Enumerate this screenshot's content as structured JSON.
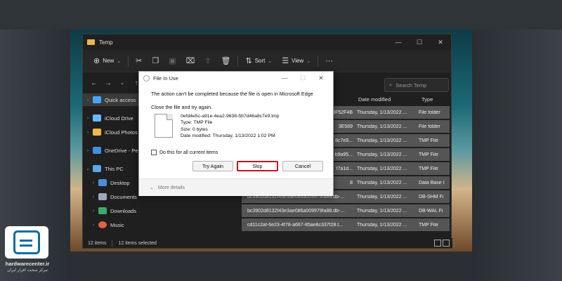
{
  "window": {
    "title": "Temp"
  },
  "toolbar": {
    "new_label": "New",
    "sort_label": "Sort",
    "view_label": "View",
    "more_label": "···"
  },
  "search": {
    "placeholder": "Search Temp"
  },
  "sidebar": {
    "items": [
      {
        "label": "Quick access",
        "icon": "star-icon",
        "color": "#4aa3ff"
      },
      {
        "label": "iCloud Drive",
        "icon": "cloud-icon",
        "color": "#6ab8ff"
      },
      {
        "label": "iCloud Photos",
        "icon": "photos-icon",
        "color": "#f0b84a"
      },
      {
        "label": "OneDrive - Pers",
        "icon": "cloud-icon",
        "color": "#3f8fe0"
      },
      {
        "label": "This PC",
        "icon": "computer-icon",
        "color": "#5aa6e8"
      },
      {
        "label": "Desktop",
        "icon": "desktop-icon",
        "color": "#4a90d9"
      },
      {
        "label": "Documents",
        "icon": "document-icon",
        "color": "#9aa8b8"
      },
      {
        "label": "Downloads",
        "icon": "download-icon",
        "color": "#3ea86f"
      },
      {
        "label": "Music",
        "icon": "music-icon",
        "color": "#e0604a"
      }
    ]
  },
  "file_list": {
    "columns": [
      "Date modified",
      "Type"
    ],
    "rows": [
      {
        "name": "",
        "id": "8F52F4B",
        "date": "Thursday, 1/13/2022 ...",
        "type": "File folder"
      },
      {
        "name": "",
        "id": "3E589",
        "date": "Thursday, 1/13/2022 ...",
        "type": "File folder"
      },
      {
        "name": "",
        "id": "8c7e9...",
        "date": "Thursday, 1/13/2022 ...",
        "type": "TMP File"
      },
      {
        "name": "",
        "id": "b9a95...",
        "date": "Thursday, 1/13/2022 ...",
        "type": "TMP File"
      },
      {
        "name": "",
        "id": "f7a1d...",
        "date": "Thursday, 1/13/2022 ...",
        "type": "TMP File"
      },
      {
        "name": "",
        "id": "8",
        "date": "Thursday, 1/13/2022 ...",
        "type": "Data Base I"
      },
      {
        "name": "bc3902d8132f43e3ae086a009979fa88.db-...",
        "date": "Thursday, 1/13/2022 ...",
        "type": "DB-SHM Fi"
      },
      {
        "name": "bc3902d8132f43e3ae086a009979fa88.db-...",
        "date": "Thursday, 1/13/2022 ...",
        "type": "DB-WAL Fi"
      },
      {
        "name": "cd11c2af-6e23-4f78-a667-85ae8c337f28.t...",
        "date": "Thursday, 1/13/2022 ...",
        "type": "TMP File"
      }
    ]
  },
  "status": {
    "count": "12 items",
    "selected": "12 items selected"
  },
  "dialog": {
    "title": "File In Use",
    "message": "The action can't be completed because the file is open in Microsoft Edge",
    "instruction": "Close the file and try again.",
    "file_name": "0efd4e5c-a91e-4ea2-9638-5b7d46a8c7e9.tmp",
    "file_type": "Type: TMP File",
    "file_size": "Size: 0 bytes",
    "file_date": "Date modified: Thursday, 1/13/2022 1:02 PM",
    "checkbox_label": "Do this for all current items",
    "try_again_label": "Try Again",
    "skip_label": "Skip",
    "cancel_label": "Cancel",
    "more_details_label": "More details"
  },
  "logo": {
    "site": "hardwarecenter.ir",
    "tagline": "مرکز سخت افزار ایران"
  }
}
